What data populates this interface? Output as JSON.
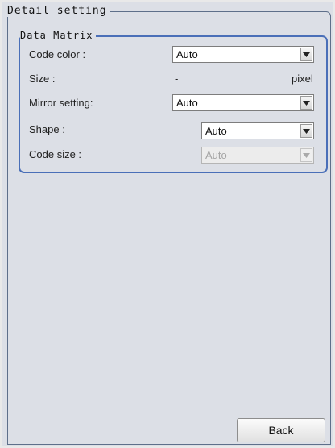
{
  "detail_setting": {
    "title": "Detail setting",
    "data_matrix": {
      "title": "Data Matrix",
      "code_color": {
        "label": "Code color :",
        "value": "Auto"
      },
      "size": {
        "label": "Size :",
        "value": "-",
        "unit": "pixel"
      },
      "mirror_setting": {
        "label": "Mirror setting:",
        "value": "Auto"
      },
      "shape": {
        "label": "Shape :",
        "value": "Auto"
      },
      "code_size": {
        "label": "Code size :",
        "value": "Auto",
        "disabled": true
      }
    }
  },
  "footer": {
    "back_label": "Back"
  },
  "icons": {
    "dropdown": "chevron-down-icon"
  },
  "colors": {
    "group_border": "#4a6fb8",
    "outer_border": "#5e6f8a",
    "panel_bg": "#dcdfe6"
  }
}
